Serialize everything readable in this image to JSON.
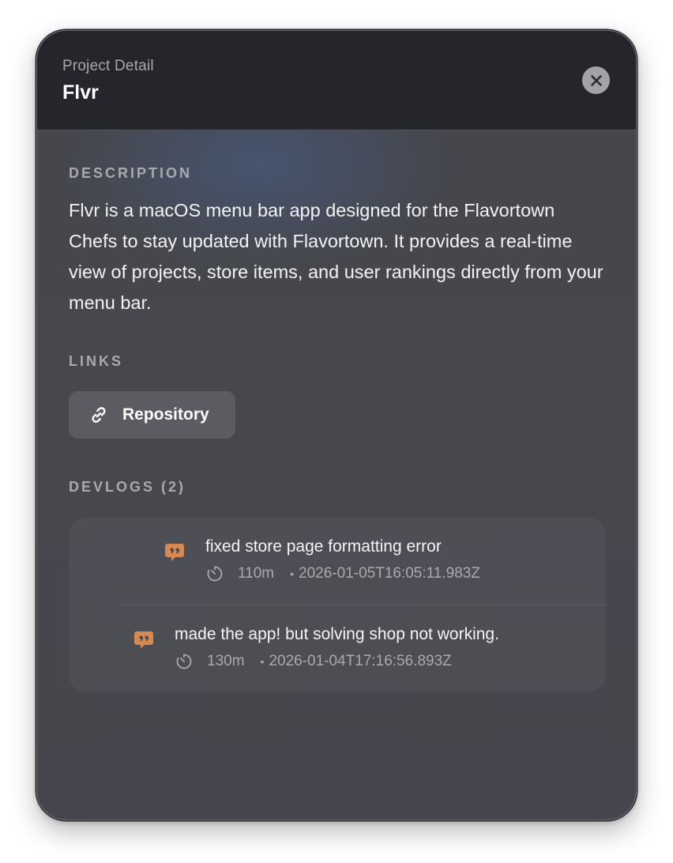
{
  "header": {
    "kicker": "Project Detail",
    "title": "Flvr",
    "close_icon": "close-icon"
  },
  "description": {
    "label": "DESCRIPTION",
    "text": "Flvr is a macOS menu bar app designed for the Flavortown Chefs to stay updated with Flavortown. It provides a real-time view of projects, store items, and user rankings directly from your menu bar."
  },
  "links": {
    "label": "LINKS",
    "items": [
      {
        "label": "Repository",
        "icon": "link-icon"
      }
    ]
  },
  "devlogs": {
    "label": "DEVLOGS (2)",
    "items": [
      {
        "title": "fixed store page formatting error",
        "duration": "110m",
        "timestamp": "2026-01-05T16:05:11.983Z",
        "icon": "quote-bubble-icon"
      },
      {
        "title": "made the app! but solving shop not working.",
        "duration": "130m",
        "timestamp": "2026-01-04T17:16:56.893Z",
        "icon": "quote-bubble-icon"
      }
    ]
  },
  "colors": {
    "header_bg": "#25252c",
    "panel_bg": "#46474d",
    "accent_orange": "#d68a52",
    "muted_text": "#a9a9ae"
  }
}
